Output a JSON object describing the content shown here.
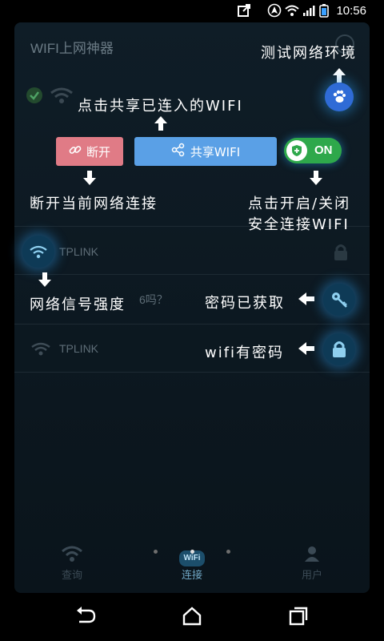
{
  "status_bar": {
    "time": "10:56",
    "icons": [
      "share-icon",
      "navigation-icon",
      "wifi-signal-icon",
      "cell-signal-icon",
      "battery-icon"
    ]
  },
  "app": {
    "title": "WIFI上网神器",
    "networks": [
      {
        "ssid": "TPLINK",
        "row": "connected-network-row"
      },
      {
        "ssid": "TPLINK",
        "row": "network-row-2"
      }
    ],
    "partial_text": "6吗？",
    "bottom_nav": [
      {
        "label": "查询",
        "icon": "wifi-icon"
      },
      {
        "label": "连接",
        "icon": "wifi-badge-icon",
        "badge": "WiFi"
      },
      {
        "label": "用户",
        "icon": "user-icon"
      }
    ]
  },
  "guide": {
    "test_network": "测试网络环境",
    "share_connected": "点击共享已连入的WIFI",
    "disconnect_current": "断开当前网络连接",
    "toggle_line1": "点击开启/关闭",
    "toggle_line2": "安全连接WIFI",
    "signal_strength": "网络信号强度",
    "password_obtained": "密码已获取",
    "wifi_has_password": "wifi有密码"
  },
  "buttons": {
    "disconnect": "断开",
    "share": "共享WIFI",
    "toggle": "ON"
  },
  "page_dots": {
    "count": 3,
    "active": 1
  },
  "colors": {
    "disconnect_button": "#e07b86",
    "share_button": "#5aa0e6",
    "toggle_on": "#2ea84b",
    "glow": "#2890d2"
  }
}
